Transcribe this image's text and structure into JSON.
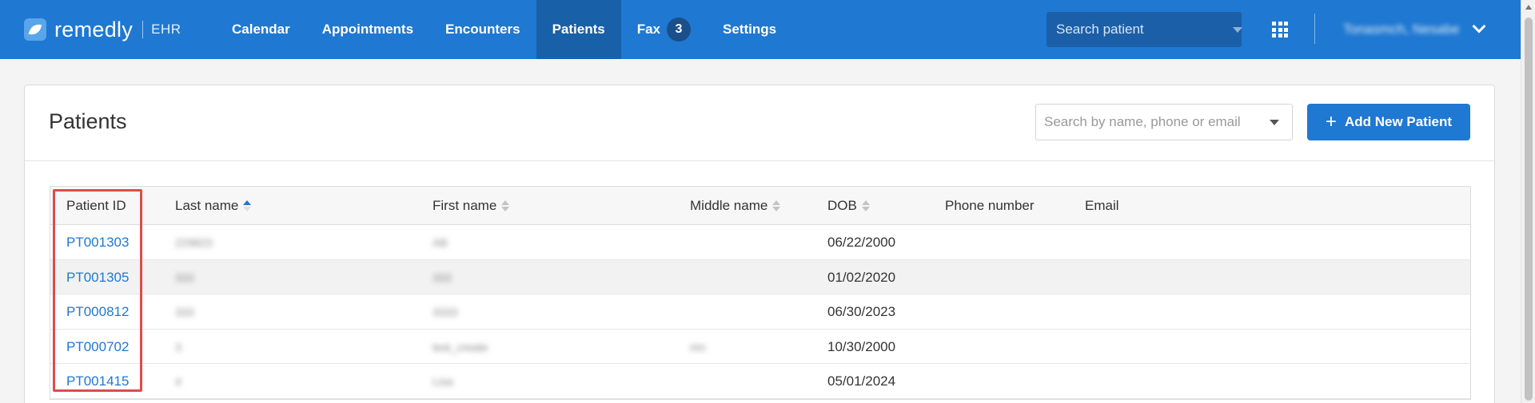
{
  "header": {
    "logo_text": "remedly",
    "logo_sub": "EHR",
    "nav": [
      {
        "label": "Calendar",
        "active": false
      },
      {
        "label": "Appointments",
        "active": false
      },
      {
        "label": "Encounters",
        "active": false
      },
      {
        "label": "Patients",
        "active": true
      },
      {
        "label": "Fax",
        "active": false,
        "badge": "3"
      },
      {
        "label": "Settings",
        "active": false
      }
    ],
    "search_placeholder": "Search patient",
    "user_name": "Tonasmch, Nesabe",
    "brand_color": "#1f78d1"
  },
  "page": {
    "title": "Patients",
    "search_placeholder": "Search by name, phone or email",
    "add_button_label": "Add New Patient"
  },
  "table": {
    "columns": [
      "Patient ID",
      "Last name",
      "First name",
      "Middle name",
      "DOB",
      "Phone number",
      "Email"
    ],
    "sort": {
      "Last name": "asc",
      "First name": "none",
      "Middle name": "none",
      "DOB": "none"
    },
    "rows": [
      {
        "id": "PT001303",
        "last": "229823",
        "first": "AB",
        "middle": "",
        "dob": "06/22/2000",
        "phone": "",
        "email": ""
      },
      {
        "id": "PT001305",
        "last": "333",
        "first": "333",
        "middle": "",
        "dob": "01/02/2020",
        "phone": "",
        "email": ""
      },
      {
        "id": "PT000812",
        "last": "333",
        "first": "3333",
        "middle": "",
        "dob": "06/30/2023",
        "phone": "",
        "email": ""
      },
      {
        "id": "PT000702",
        "last": "3",
        "first": "test_create",
        "middle": "mn",
        "dob": "10/30/2000",
        "phone": "",
        "email": ""
      },
      {
        "id": "PT001415",
        "last": "4",
        "first": "Lisa",
        "middle": "",
        "dob": "05/01/2024",
        "phone": "",
        "email": ""
      }
    ]
  }
}
